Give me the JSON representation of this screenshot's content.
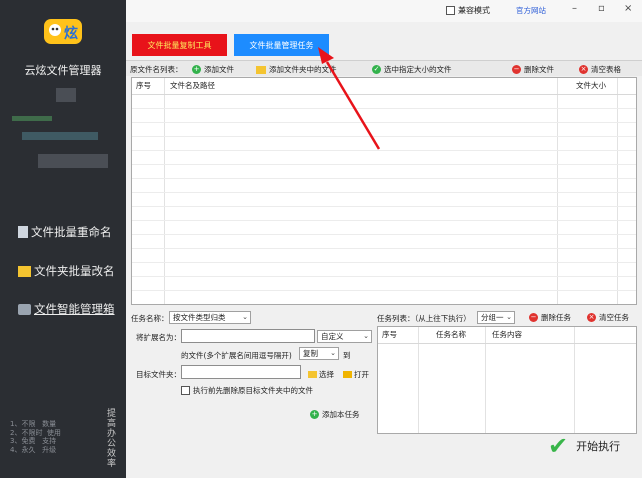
{
  "sidebar": {
    "app_name": "云炫文件管理器",
    "logo_text": "炫",
    "items": [
      {
        "label": "文件批量重命名"
      },
      {
        "label": "文件夹批量改名"
      },
      {
        "label": "文件智能管理箱"
      }
    ],
    "tips": [
      "1、不限",
      "2、不限时",
      "3、免费",
      "4、永久"
    ],
    "tips_right": [
      "数量",
      "使用",
      "支持",
      "升级"
    ],
    "slogan": "提高办公效率"
  },
  "titlebar": {
    "compat_label": "兼容模式",
    "official_site": "官方网站",
    "minimize": "–",
    "maximize": "▫",
    "close": "×"
  },
  "tabs": {
    "red": "文件批量复制工具",
    "blue": "文件批量管理任务"
  },
  "toolbar": {
    "source_label": "原文件名列表：",
    "add_file": "添加文件",
    "add_folder_files": "添加文件夹中的文件",
    "select_size": "选中指定大小的文件",
    "delete_file": "删除文件",
    "clear_table": "清空表格"
  },
  "file_table": {
    "headers": [
      "序号",
      "文件名及路径",
      "文件大小"
    ]
  },
  "task_form": {
    "task_name_label": "任务名称：",
    "task_name_value": "按文件类型归类",
    "ext_label": "将扩展名为：",
    "ext_mode": "自定义",
    "ext_hint": "的文件(多个扩展名间用逗号隔开)",
    "action": "复制",
    "to_label": "到",
    "target_label": "目标文件夹：",
    "choose": "选择",
    "open": "打开",
    "delete_before": "执行前先删除原目标文件夹中的文件",
    "add_task": "添加本任务"
  },
  "task_list": {
    "label": "任务列表：（从上往下执行）",
    "group": "分组一",
    "delete_task": "删除任务",
    "clear_task": "清空任务",
    "headers": [
      "序号",
      "任务名称",
      "任务内容"
    ]
  },
  "start_button": "开始执行",
  "colors": {
    "sidebar": "#2b2e33",
    "tab_red": "#e8131a",
    "tab_red_text": "#ffe85c",
    "tab_blue": "#1d8cff",
    "arrow": "#e8131a",
    "accent_green": "#39b54a"
  }
}
